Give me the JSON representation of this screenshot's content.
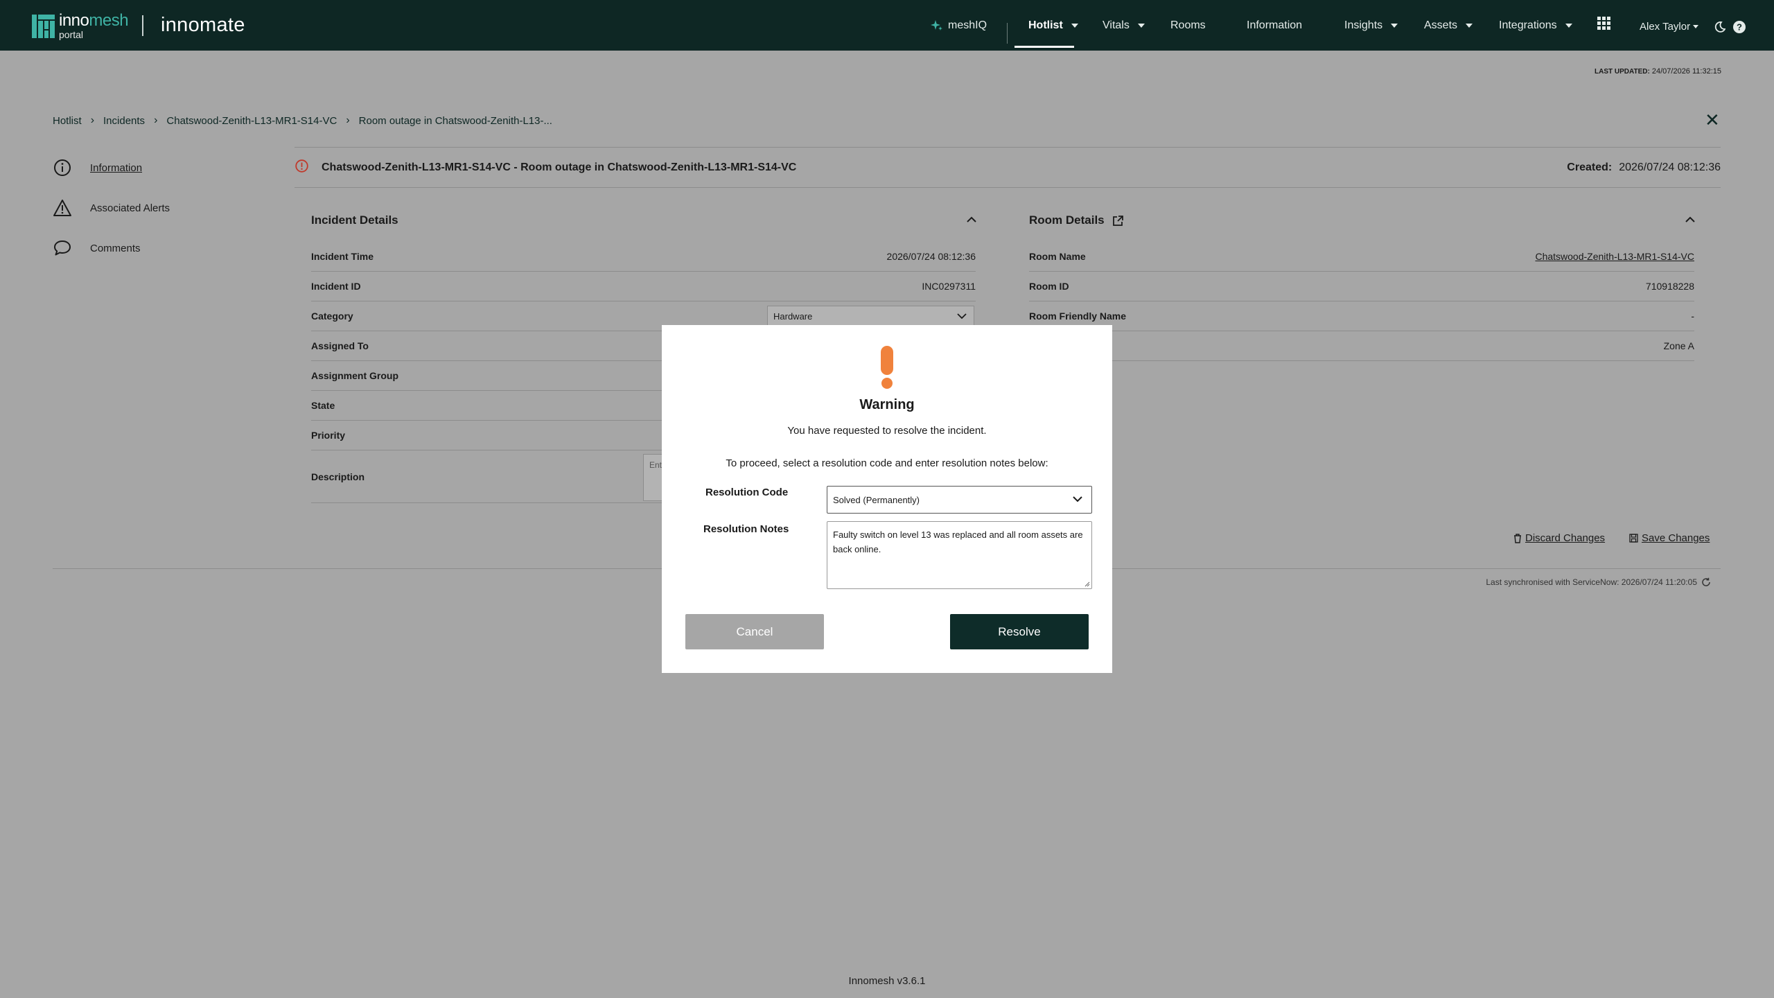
{
  "brand": {
    "name_part1": "inno",
    "name_part2": "mesh",
    "sub": "portal",
    "product": "innomate"
  },
  "nav": {
    "meshiq": "meshIQ",
    "hotlist": "Hotlist",
    "vitals": "Vitals",
    "rooms": "Rooms",
    "information": "Information",
    "insights": "Insights",
    "assets": "Assets",
    "integrations": "Integrations",
    "user": "Alex Taylor"
  },
  "last_updated": {
    "label": "LAST UPDATED:",
    "value": "24/07/2026 11:32:15"
  },
  "breadcrumb": [
    "Hotlist",
    "Incidents",
    "Chatswood-Zenith-L13-MR1-S14-VC",
    "Room outage in Chatswood-Zenith-L13-..."
  ],
  "sidebar": {
    "items": [
      {
        "label": "Information",
        "icon": "info-icon"
      },
      {
        "label": "Associated Alerts",
        "icon": "alert-triangle-icon"
      },
      {
        "label": "Comments",
        "icon": "comment-icon"
      }
    ]
  },
  "incident": {
    "title": "Chatswood-Zenith-L13-MR1-S14-VC - Room outage in Chatswood-Zenith-L13-MR1-S14-VC",
    "created_label": "Created:",
    "created_value": "2026/07/24 08:12:36"
  },
  "incident_details": {
    "header": "Incident Details",
    "rows": [
      {
        "key": "Incident Time",
        "value": "2026/07/24 08:12:36"
      },
      {
        "key": "Incident ID",
        "value": "INC0297311"
      },
      {
        "key": "Category",
        "value": "Hardware"
      },
      {
        "key": "Assigned To",
        "value": ""
      },
      {
        "key": "Assignment Group",
        "value": ""
      },
      {
        "key": "State",
        "value": ""
      },
      {
        "key": "Priority",
        "value": ""
      },
      {
        "key": "Description",
        "value": ""
      }
    ],
    "description_placeholder": "Ent"
  },
  "room_details": {
    "header": "Room Details",
    "rows": [
      {
        "key": "Room Name",
        "value": "Chatswood-Zenith-L13-MR1-S14-VC"
      },
      {
        "key": "Room ID",
        "value": "710918228"
      },
      {
        "key": "Room Friendly Name",
        "value": "-"
      },
      {
        "key": "",
        "value": "Zone A"
      }
    ]
  },
  "actions": {
    "discard": "Discard Changes",
    "save": "Save Changes"
  },
  "sync": "Last synchronised with ServiceNow: 2026/07/24 11:20:05",
  "footer": "Innomesh v3.6.1",
  "modal": {
    "title": "Warning",
    "message1": "You have requested to resolve the incident.",
    "message2": "To proceed, select a resolution code and enter resolution notes below:",
    "resolution_code_label": "Resolution Code",
    "resolution_code_value": "Solved (Permanently)",
    "resolution_notes_label": "Resolution Notes",
    "resolution_notes_value": "Faulty switch on level 13 was replaced and all room assets are back online.",
    "cancel": "Cancel",
    "resolve": "Resolve",
    "warning_color": "#f0823c"
  }
}
